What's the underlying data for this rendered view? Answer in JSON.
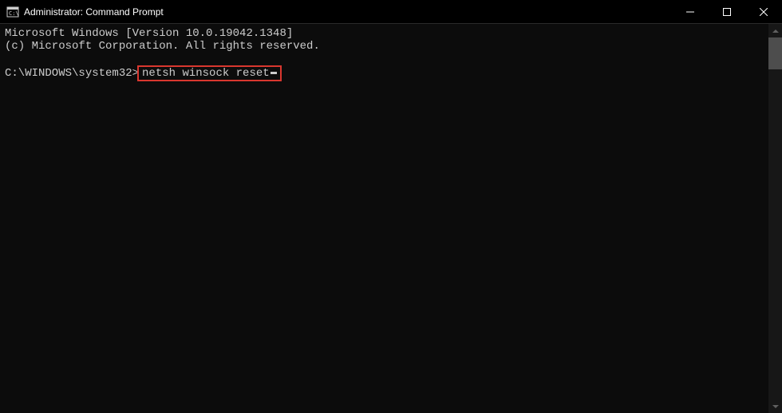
{
  "window": {
    "title": "Administrator: Command Prompt"
  },
  "terminal": {
    "line1": "Microsoft Windows [Version 10.0.19042.1348]",
    "line2": "(c) Microsoft Corporation. All rights reserved.",
    "prompt": "C:\\WINDOWS\\system32>",
    "command": "netsh winsock reset"
  }
}
